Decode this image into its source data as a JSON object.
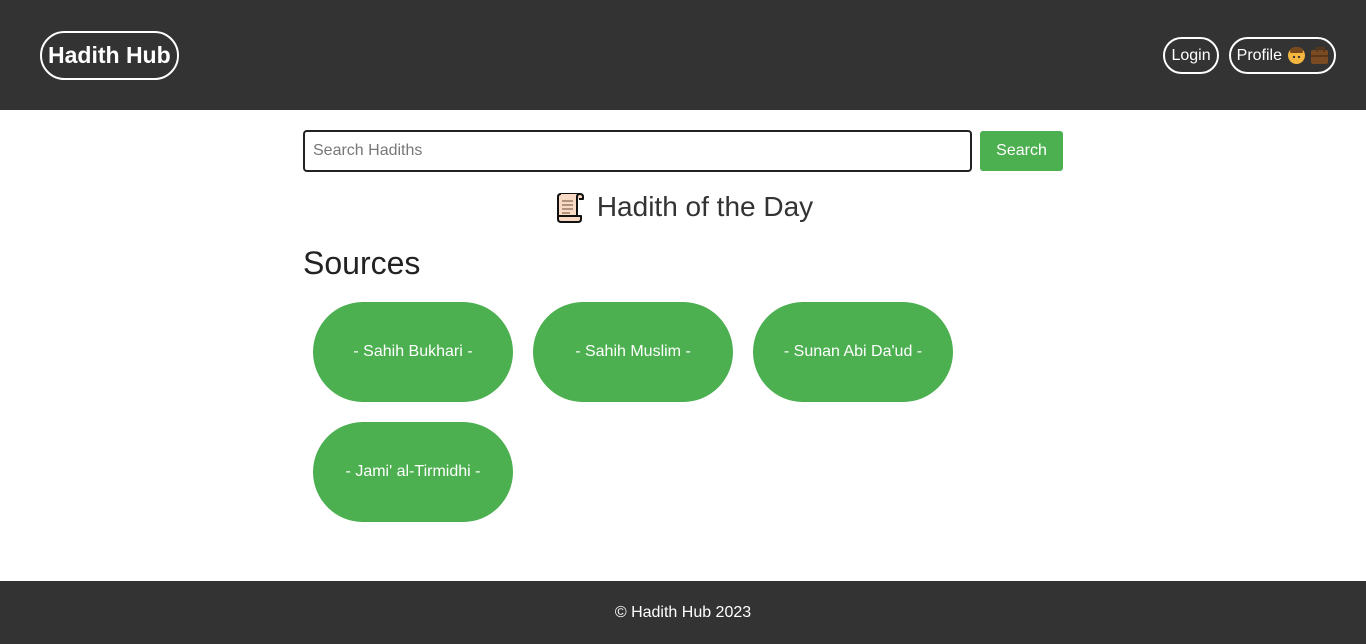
{
  "header": {
    "logo": "Hadith Hub",
    "nav": {
      "login": "Login",
      "profile": "Profile"
    }
  },
  "search": {
    "placeholder": "Search Hadiths",
    "value": "",
    "button": "Search"
  },
  "hadith_of_day": {
    "icon": "scroll-icon",
    "title": "Hadith of the Day"
  },
  "sources": {
    "title": "Sources",
    "items": [
      "- Sahih Bukhari -",
      "- Sahih Muslim -",
      "- Sunan Abi Da'ud -",
      "- Jami' al-Tirmidhi -"
    ]
  },
  "footer": {
    "text": "© Hadith Hub 2023"
  },
  "colors": {
    "header_bg": "#333333",
    "accent": "#4caf50",
    "footer_bg": "#333333"
  }
}
